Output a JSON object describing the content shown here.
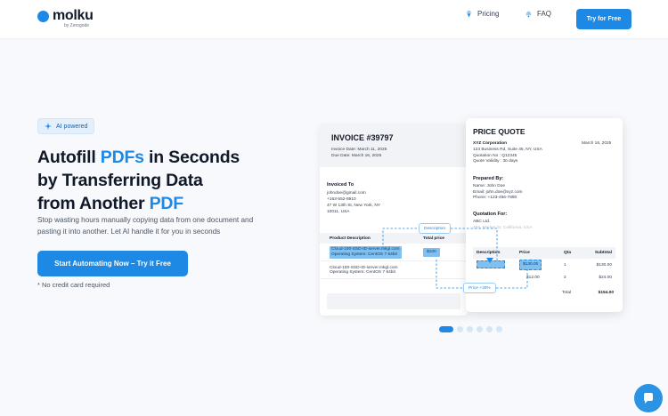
{
  "header": {
    "brand": "molku",
    "brand_sub": "by Zerogode",
    "nav": [
      {
        "label": "Pricing",
        "icon": "ice-cream-icon"
      },
      {
        "label": "FAQ",
        "icon": "bell-icon"
      }
    ],
    "cta_label": "Try for Free"
  },
  "hero": {
    "badge": "AI powered",
    "headline": {
      "p1": "Autofill ",
      "h1": "PDFs",
      "p2": " in Seconds",
      "p3": "by Transferring Data",
      "p4": "from Another ",
      "h2": "PDF"
    },
    "subtext": "Stop wasting hours manually copying data from one document and pasting it into another. Let AI handle it for you in seconds",
    "cta_label": "Start Automating Now – Try it Free",
    "note": "* No credit card required"
  },
  "invoice": {
    "title": "INVOICE #39797",
    "invoice_date": "Invoice Date: March 11, 2025",
    "due_date": "Due Date: March 16, 2025",
    "to_label": "Invoiced To",
    "to_email": "johndoe@gmail.com",
    "to_phone": "+163-552-8910",
    "to_addr1": "47 W 13th St, New York, NY",
    "to_addr2": "10011, USA",
    "col_desc": "Product Description",
    "col_total": "Total price",
    "rows": [
      {
        "line1": "Cloud-100-SSD-ID-server.mkgl.com",
        "line2": "Operating System: CentOS 7 64bit",
        "total": "$100"
      },
      {
        "line1": "Cloud-100-SSD-ID-server.mkgl.com",
        "line2": "Operating System: CentOS 7 64bit",
        "total": ""
      }
    ]
  },
  "quote": {
    "title": "PRICE QUOTE",
    "company": "XYZ Corporation",
    "address": "123 Business Rd, Suite 45, NY, USA",
    "quotation_no": "Quotation No : Q12345",
    "validity": "Quote Validity : 30 days",
    "date": "March 16, 2025",
    "prepared_label": "Prepared By:",
    "prepared_name": "Name: John Doe",
    "prepared_email": "Email: john.doe@xyz.com",
    "prepared_phone": "Phone: +123-456-7890",
    "for_label": "Quotation For:",
    "for_company": "ABC Ltd.",
    "for_address": "456, Market St, California, USA",
    "col_desc": "Description",
    "col_price": "Price",
    "col_qty": "Qta",
    "col_sub": "Subtotal",
    "rows": [
      {
        "price": "$130.00",
        "qty": "1",
        "subtotal": "$130.00"
      },
      {
        "price": "$12.00",
        "qty": "2",
        "subtotal": "$24.00"
      }
    ],
    "total_label": "Total",
    "total_value": "$154.00"
  },
  "tags": {
    "description": "Description",
    "price": "Price +30%"
  },
  "carousel": {
    "count": 6,
    "active": 0
  },
  "colors": {
    "accent": "#1e88e5",
    "highlight": "#7fc0f0"
  }
}
